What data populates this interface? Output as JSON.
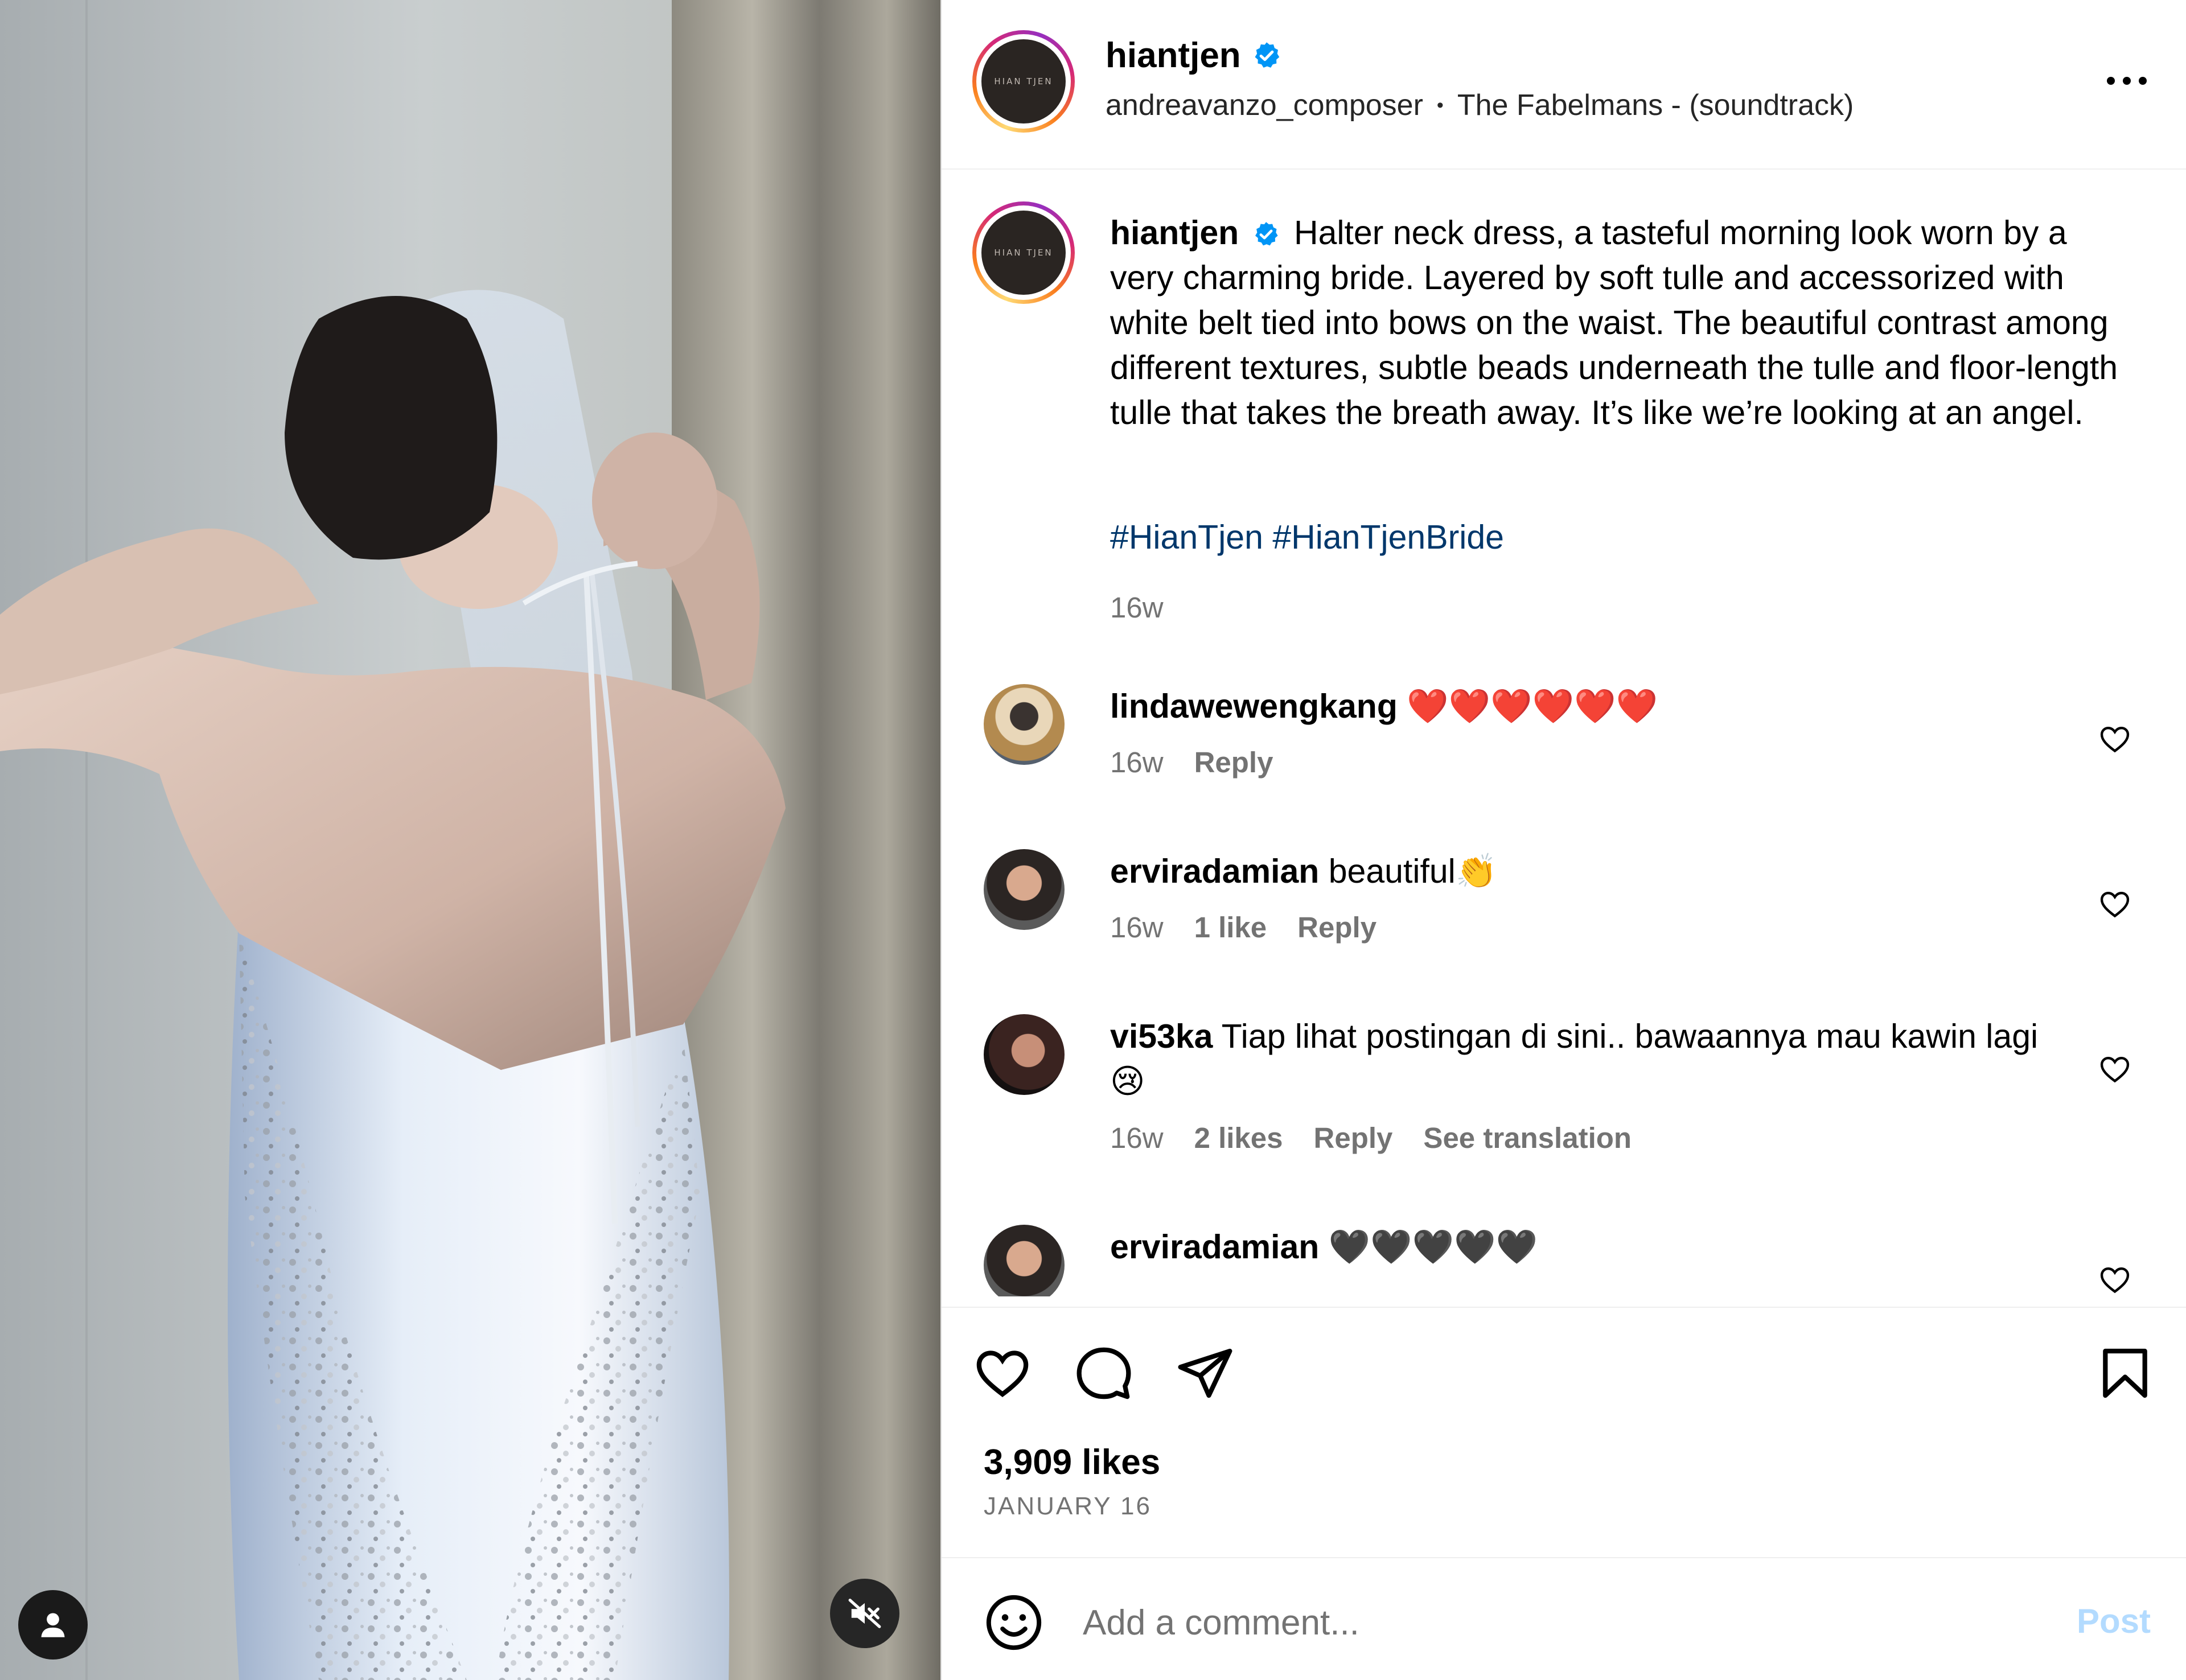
{
  "post": {
    "author": "hiantjen",
    "avatar_text": "HIAN TJEN",
    "audio_artist": "andreavanzo_composer",
    "audio_title": "The Fabelmans - (soundtrack)",
    "separator": "•"
  },
  "caption": {
    "author": "hiantjen",
    "text": "Halter neck dress, a tasteful morning look worn by a very charming bride. Layered by soft tulle and accessorized with white belt tied into bows on the waist. The beautiful contrast among different textures, subtle beads underneath the tulle and floor-length tulle that takes the breath away. It’s like we’re looking at an angel.",
    "hashtags": "#HianTjen #HianTjenBride",
    "time": "16w"
  },
  "comments": [
    {
      "user": "lindawewengkang",
      "text": "❤️❤️❤️❤️❤️❤️",
      "time": "16w",
      "likes": "",
      "reply": "Reply",
      "translate": ""
    },
    {
      "user": "erviradamian",
      "text": "beautiful👏",
      "time": "16w",
      "likes": "1 like",
      "reply": "Reply",
      "translate": ""
    },
    {
      "user": "vi53ka",
      "text": "Tiap lihat postingan di sini.. bawaannya mau kawin lagi 😢",
      "time": "16w",
      "likes": "2 likes",
      "reply": "Reply",
      "translate": "See translation"
    },
    {
      "user": "erviradamian",
      "text": "🖤🖤🖤🖤🖤",
      "time": "",
      "likes": "",
      "reply": "",
      "translate": ""
    }
  ],
  "stats": {
    "likes": "3,909 likes",
    "date": "JANUARY 16"
  },
  "composer": {
    "placeholder": "Add a comment...",
    "post_label": "Post"
  },
  "colors": {
    "link": "#00376b",
    "muted": "#737373",
    "verified": "#0095f6",
    "post_disabled": "#b3dbff",
    "heart_red": "#ed1c24"
  },
  "icons": {
    "verified": "verified-badge-icon",
    "more": "more-options-icon",
    "like": "heart-icon",
    "comment": "comment-bubble-icon",
    "share": "paper-plane-icon",
    "save": "bookmark-icon",
    "emoji": "smiley-icon",
    "tag": "person-tag-icon",
    "mute": "speaker-muted-icon"
  }
}
